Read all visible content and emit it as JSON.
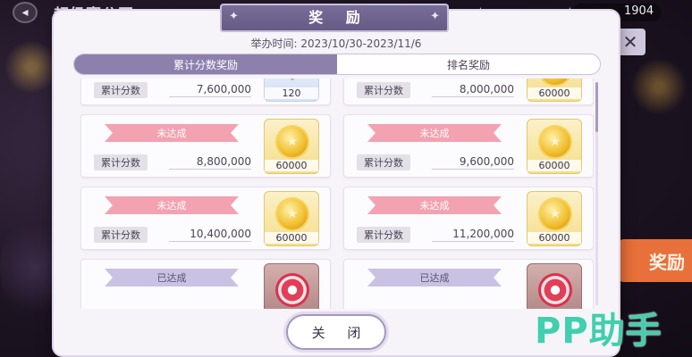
{
  "background": {
    "title": "超级赛公开",
    "currency_value": "1904",
    "reward_button_label": "奖励",
    "back_icon": "back-arrow-icon",
    "close_icon": "close-icon"
  },
  "dialog": {
    "title": "奖 励",
    "period": "举办时间: 2023/10/30-2023/11/6",
    "tabs": [
      {
        "label": "累计分数奖励",
        "active": true
      },
      {
        "label": "排名奖励",
        "active": false
      }
    ],
    "close_label": "关 闭"
  },
  "milestones": [
    {
      "status": "",
      "score_label": "累计分数",
      "score": "7,600,000",
      "reward_icon": "gem-icon",
      "reward_qty": "120"
    },
    {
      "status": "",
      "score_label": "累计分数",
      "score": "8,000,000",
      "reward_icon": "coin-icon",
      "reward_qty": "60000"
    },
    {
      "status": "未达成",
      "score_label": "累计分数",
      "score": "8,800,000",
      "reward_icon": "coin-icon",
      "reward_qty": "60000"
    },
    {
      "status": "未达成",
      "score_label": "累计分数",
      "score": "9,600,000",
      "reward_icon": "coin-icon",
      "reward_qty": "60000"
    },
    {
      "status": "未达成",
      "score_label": "累计分数",
      "score": "10,400,000",
      "reward_icon": "coin-icon",
      "reward_qty": "60000"
    },
    {
      "status": "未达成",
      "score_label": "累计分数",
      "score": "11,200,000",
      "reward_icon": "coin-icon",
      "reward_qty": "60000"
    },
    {
      "status": "已达成",
      "score_label": "",
      "score": "",
      "reward_icon": "badge-icon",
      "reward_qty": ""
    },
    {
      "status": "已达成",
      "score_label": "",
      "score": "",
      "reward_icon": "badge-icon",
      "reward_qty": ""
    }
  ],
  "watermark": "PP助手",
  "colors": {
    "accent": "#8d80ad",
    "pending_ribbon": "#f2a2b0",
    "done_ribbon": "#c9c2e2",
    "watermark": "#41cfae"
  }
}
